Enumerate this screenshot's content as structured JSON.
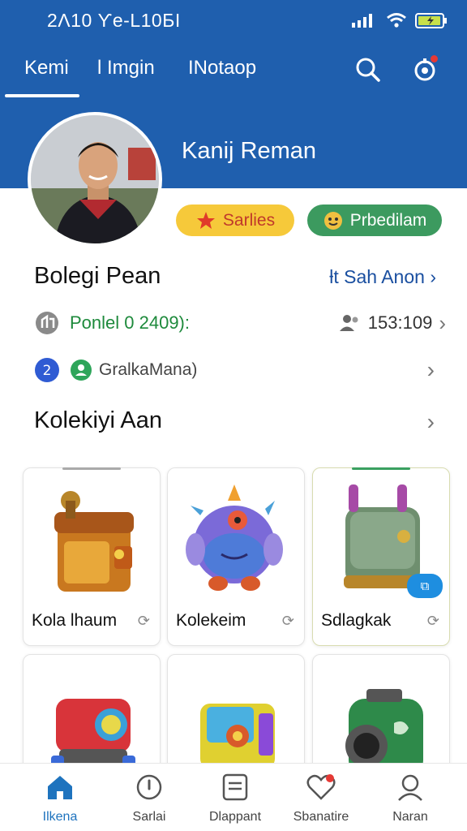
{
  "status_bar": {
    "time": "2Λ10 Ƴe-L10БI"
  },
  "tabs": [
    {
      "label": "Kemi",
      "active": true
    },
    {
      "label": "l Imgin"
    },
    {
      "label": "INotaop"
    }
  ],
  "profile": {
    "name": "Kanij Reman"
  },
  "badges": {
    "gold": "Sarlies",
    "green": "Prbedilam"
  },
  "section1": {
    "title": "Bolegi Pean",
    "link": "ƚt Sah Anon"
  },
  "rows": {
    "stat_label": "Ponlel 0 2409):",
    "stat_count": "153:109",
    "account_label": "GralkaMana)"
  },
  "collection": {
    "title": "Kolekiyi Aan",
    "items": [
      {
        "label": "Kola lhaum",
        "action": "⟳"
      },
      {
        "label": "Kolekeim",
        "action": "⟳"
      },
      {
        "label": "Sdlagkak",
        "action": "⟳"
      }
    ]
  },
  "bottom_nav": [
    {
      "label": "Ilkena",
      "active": true
    },
    {
      "label": "Sarlai"
    },
    {
      "label": "Dlappant"
    },
    {
      "label": "Sbanatire"
    },
    {
      "label": "Naran"
    }
  ],
  "colors": {
    "header": "#1f5fae",
    "gold": "#f6c93a",
    "green": "#3c9a5f",
    "link": "#1a4fa0",
    "active_nav": "#1e73be"
  }
}
